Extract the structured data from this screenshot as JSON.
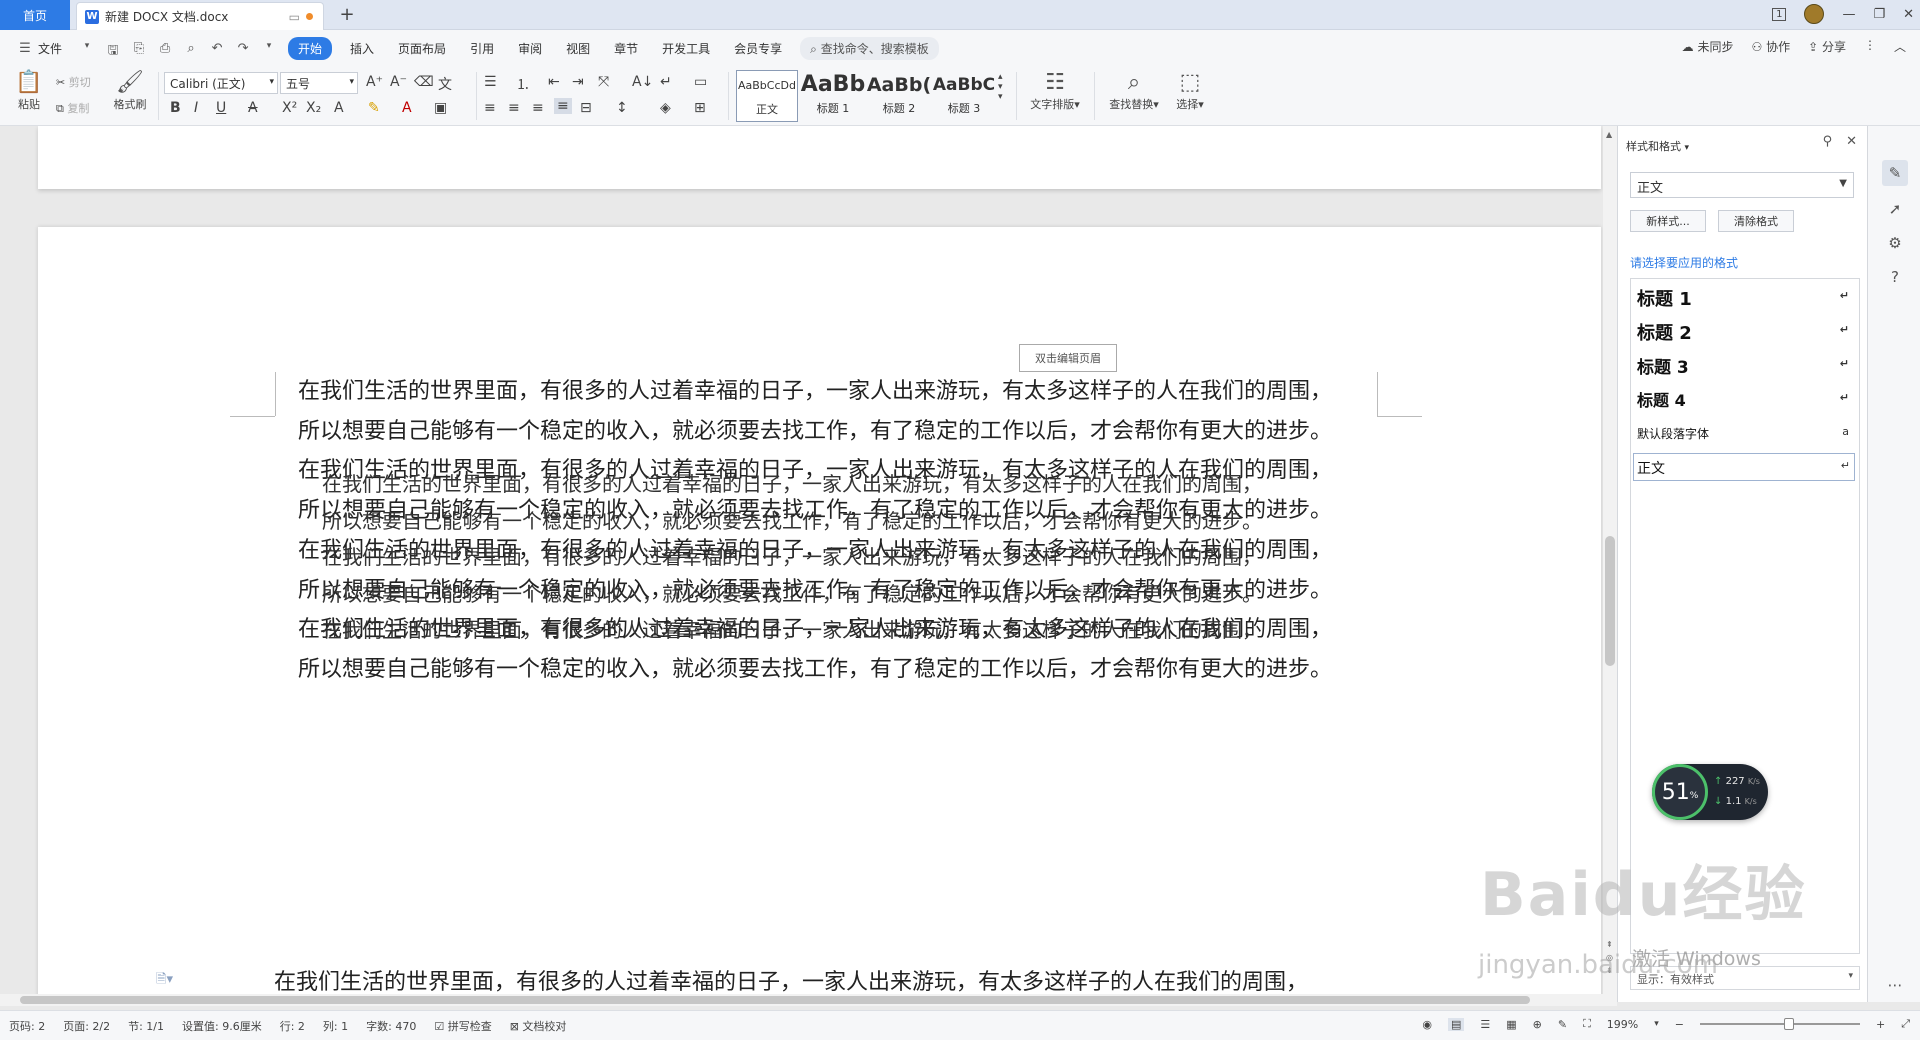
{
  "tabs": {
    "home": "首页",
    "doc_title": "新建 DOCX 文档.docx",
    "add": "+"
  },
  "window": {
    "page_badge": "1",
    "restore": "❐",
    "close": "✕",
    "minimize": "—"
  },
  "menu": {
    "file": "文件",
    "items": [
      "开始",
      "插入",
      "页面布局",
      "引用",
      "审阅",
      "视图",
      "章节",
      "开发工具",
      "会员专享"
    ],
    "search": "查找命令、搜索模板",
    "right": [
      "未同步",
      "协作",
      "分享"
    ]
  },
  "ribbon": {
    "paste": "粘贴",
    "cut": "剪切",
    "copy": "复制",
    "format_painter": "格式刷",
    "font_name": "Calibri (正文)",
    "font_size": "五号",
    "styles": [
      {
        "preview": "AaBbCcDd",
        "label": "正文"
      },
      {
        "preview": "AaBb",
        "label": "标题 1"
      },
      {
        "preview": "AaBb(",
        "label": "标题 2"
      },
      {
        "preview": "AaBbC",
        "label": "标题 3"
      }
    ],
    "text_layout": "文字排版",
    "find_replace": "查找替换",
    "select": "选择"
  },
  "document": {
    "header_hint": "双击编辑页眉",
    "line_a": "在我们生活的世界里面，有很多的人过着幸福的日子，一家人出来游玩，有太多这样子的人在我们的周围，",
    "line_b": "所以想要自己能够有一个稳定的收入，就必须要去找工作，有了稳定的工作以后，才会帮你有更大的进步。"
  },
  "panel": {
    "title": "样式和格式",
    "current_style": "正文",
    "new_style": "新样式...",
    "clear_format": "清除格式",
    "apply_hint": "请选择要应用的格式",
    "items": [
      {
        "name": "标题 1",
        "mark": "↵"
      },
      {
        "name": "标题 2",
        "mark": "↵"
      },
      {
        "name": "标题 3",
        "mark": "↵"
      },
      {
        "name": "标题 4",
        "mark": "↵"
      },
      {
        "name": "默认段落字体",
        "mark": "a"
      },
      {
        "name": "正文",
        "mark": "↵"
      }
    ],
    "bottom": "显示：有效样式"
  },
  "speed_widget": {
    "percent": "51",
    "percent_sign": "%",
    "up": "227",
    "up_unit": "K/s",
    "down": "1.1",
    "down_unit": "K/s"
  },
  "watermark": {
    "logo": "Baidu经验",
    "url": "jingyan.baidu.com",
    "activation": "激活 Windows"
  },
  "status": {
    "page_num": "页码: 2",
    "pages": "页面: 2/2",
    "section": "节: 1/1",
    "setting": "设置值: 9.6厘米",
    "row": "行: 2",
    "col": "列: 1",
    "words": "字数: 470",
    "spell": "拼写检查",
    "proof": "文档校对",
    "zoom": "199%"
  }
}
